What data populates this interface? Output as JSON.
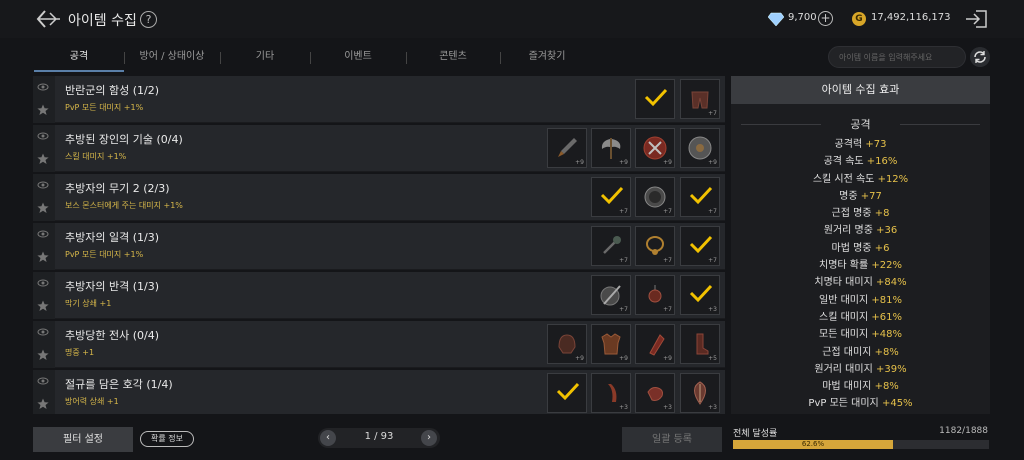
{
  "header": {
    "title": "아이템 수집",
    "help_icon": "?",
    "gem_count": "9,700",
    "plus_icon": "+",
    "gold_icon": "G",
    "gold_count": "17,492,116,173"
  },
  "tabs": [
    {
      "label": "공격",
      "active": true
    },
    {
      "label": "방어 / 상태이상"
    },
    {
      "label": "기타"
    },
    {
      "label": "이벤트"
    },
    {
      "label": "콘텐츠"
    },
    {
      "label": "즐겨찾기"
    }
  ],
  "search": {
    "placeholder": "아이템 이름을 입력해주세요"
  },
  "collections": [
    {
      "title": "반란군의 함성 (1/2)",
      "effect": "PvP 모든 대미지 +1%",
      "slots": [
        {
          "icon": "check-icon",
          "done": true,
          "level": ""
        },
        {
          "icon": "pants-icon",
          "done": false,
          "level": "+7"
        }
      ]
    },
    {
      "title": "추방된 장인의 기술 (0/4)",
      "effect": "스킬 대미지 +1%",
      "slots": [
        {
          "icon": "dagger-icon",
          "level": "+9"
        },
        {
          "icon": "axe-icon",
          "level": "+9"
        },
        {
          "icon": "shield-icon",
          "level": "+9"
        },
        {
          "icon": "round-shield-icon",
          "level": "+9"
        }
      ]
    },
    {
      "title": "추방자의 무기 2 (2/3)",
      "effect": "보스 몬스터에게 주는 대미지 +1%",
      "slots": [
        {
          "icon": "check-icon",
          "done": true,
          "level": "+7"
        },
        {
          "icon": "orb-icon",
          "level": "+7"
        },
        {
          "icon": "check-icon",
          "done": true,
          "level": "+7"
        }
      ]
    },
    {
      "title": "추방자의 일격 (1/3)",
      "effect": "PvP 모든 대미지 +1%",
      "slots": [
        {
          "icon": "mace-icon",
          "level": "+7"
        },
        {
          "icon": "necklace-icon",
          "level": "+7"
        },
        {
          "icon": "check-icon",
          "done": true,
          "level": "+7"
        }
      ]
    },
    {
      "title": "추방자의 반격 (1/3)",
      "effect": "막기 상쇄 +1",
      "slots": [
        {
          "icon": "shield-sword-icon",
          "level": "+7"
        },
        {
          "icon": "amulet-icon",
          "level": "+7"
        },
        {
          "icon": "check-icon",
          "done": true,
          "level": "+3"
        }
      ]
    },
    {
      "title": "추방당한 전사 (0/4)",
      "effect": "명중 +1",
      "slots": [
        {
          "icon": "helmet-icon",
          "level": "+9"
        },
        {
          "icon": "armor-icon",
          "level": "+9"
        },
        {
          "icon": "gauntlet-icon",
          "level": "+9"
        },
        {
          "icon": "boots-icon",
          "level": "+5"
        }
      ]
    },
    {
      "title": "절규를 담은 호각 (1/4)",
      "effect": "방어력 상쇄 +1",
      "slots": [
        {
          "icon": "check-icon",
          "done": true,
          "level": ""
        },
        {
          "icon": "horn-icon",
          "level": "+3"
        },
        {
          "icon": "glove-icon",
          "level": "+3"
        },
        {
          "icon": "leaf-shield-icon",
          "level": "+3"
        }
      ]
    }
  ],
  "panel": {
    "title": "아이템 수집 효과",
    "section": "공격",
    "stats": [
      {
        "name": "공격력",
        "value": "+73"
      },
      {
        "name": "공격 속도",
        "value": "+16%"
      },
      {
        "name": "스킬 시전 속도",
        "value": "+12%"
      },
      {
        "name": "명중",
        "value": "+77"
      },
      {
        "name": "근접 명중",
        "value": "+8"
      },
      {
        "name": "원거리 명중",
        "value": "+36"
      },
      {
        "name": "마법 명중",
        "value": "+6"
      },
      {
        "name": "치명타 확률",
        "value": "+22%"
      },
      {
        "name": "치명타 대미지",
        "value": "+84%"
      },
      {
        "name": "일반 대미지",
        "value": "+81%"
      },
      {
        "name": "스킬 대미지",
        "value": "+61%"
      },
      {
        "name": "모든 대미지",
        "value": "+48%"
      },
      {
        "name": "근접 대미지",
        "value": "+8%"
      },
      {
        "name": "원거리 대미지",
        "value": "+39%"
      },
      {
        "name": "마법 대미지",
        "value": "+8%"
      },
      {
        "name": "PvP 모든 대미지",
        "value": "+45%"
      }
    ]
  },
  "footer": {
    "filter_label": "필터 설정",
    "prob_label": "확률 정보",
    "prev_icon": "‹",
    "next_icon": "›",
    "page_text": "1 / 93",
    "bulk_label": "일괄 등록",
    "progress_label": "전체 달성률",
    "progress_count": "1182/1888",
    "progress_pct_text": "62.6%",
    "progress_fraction": 0.626
  },
  "colors": {
    "accent_gold": "#e6c14a",
    "check_yellow": "#f2c200",
    "progress": "#d6a63a"
  }
}
